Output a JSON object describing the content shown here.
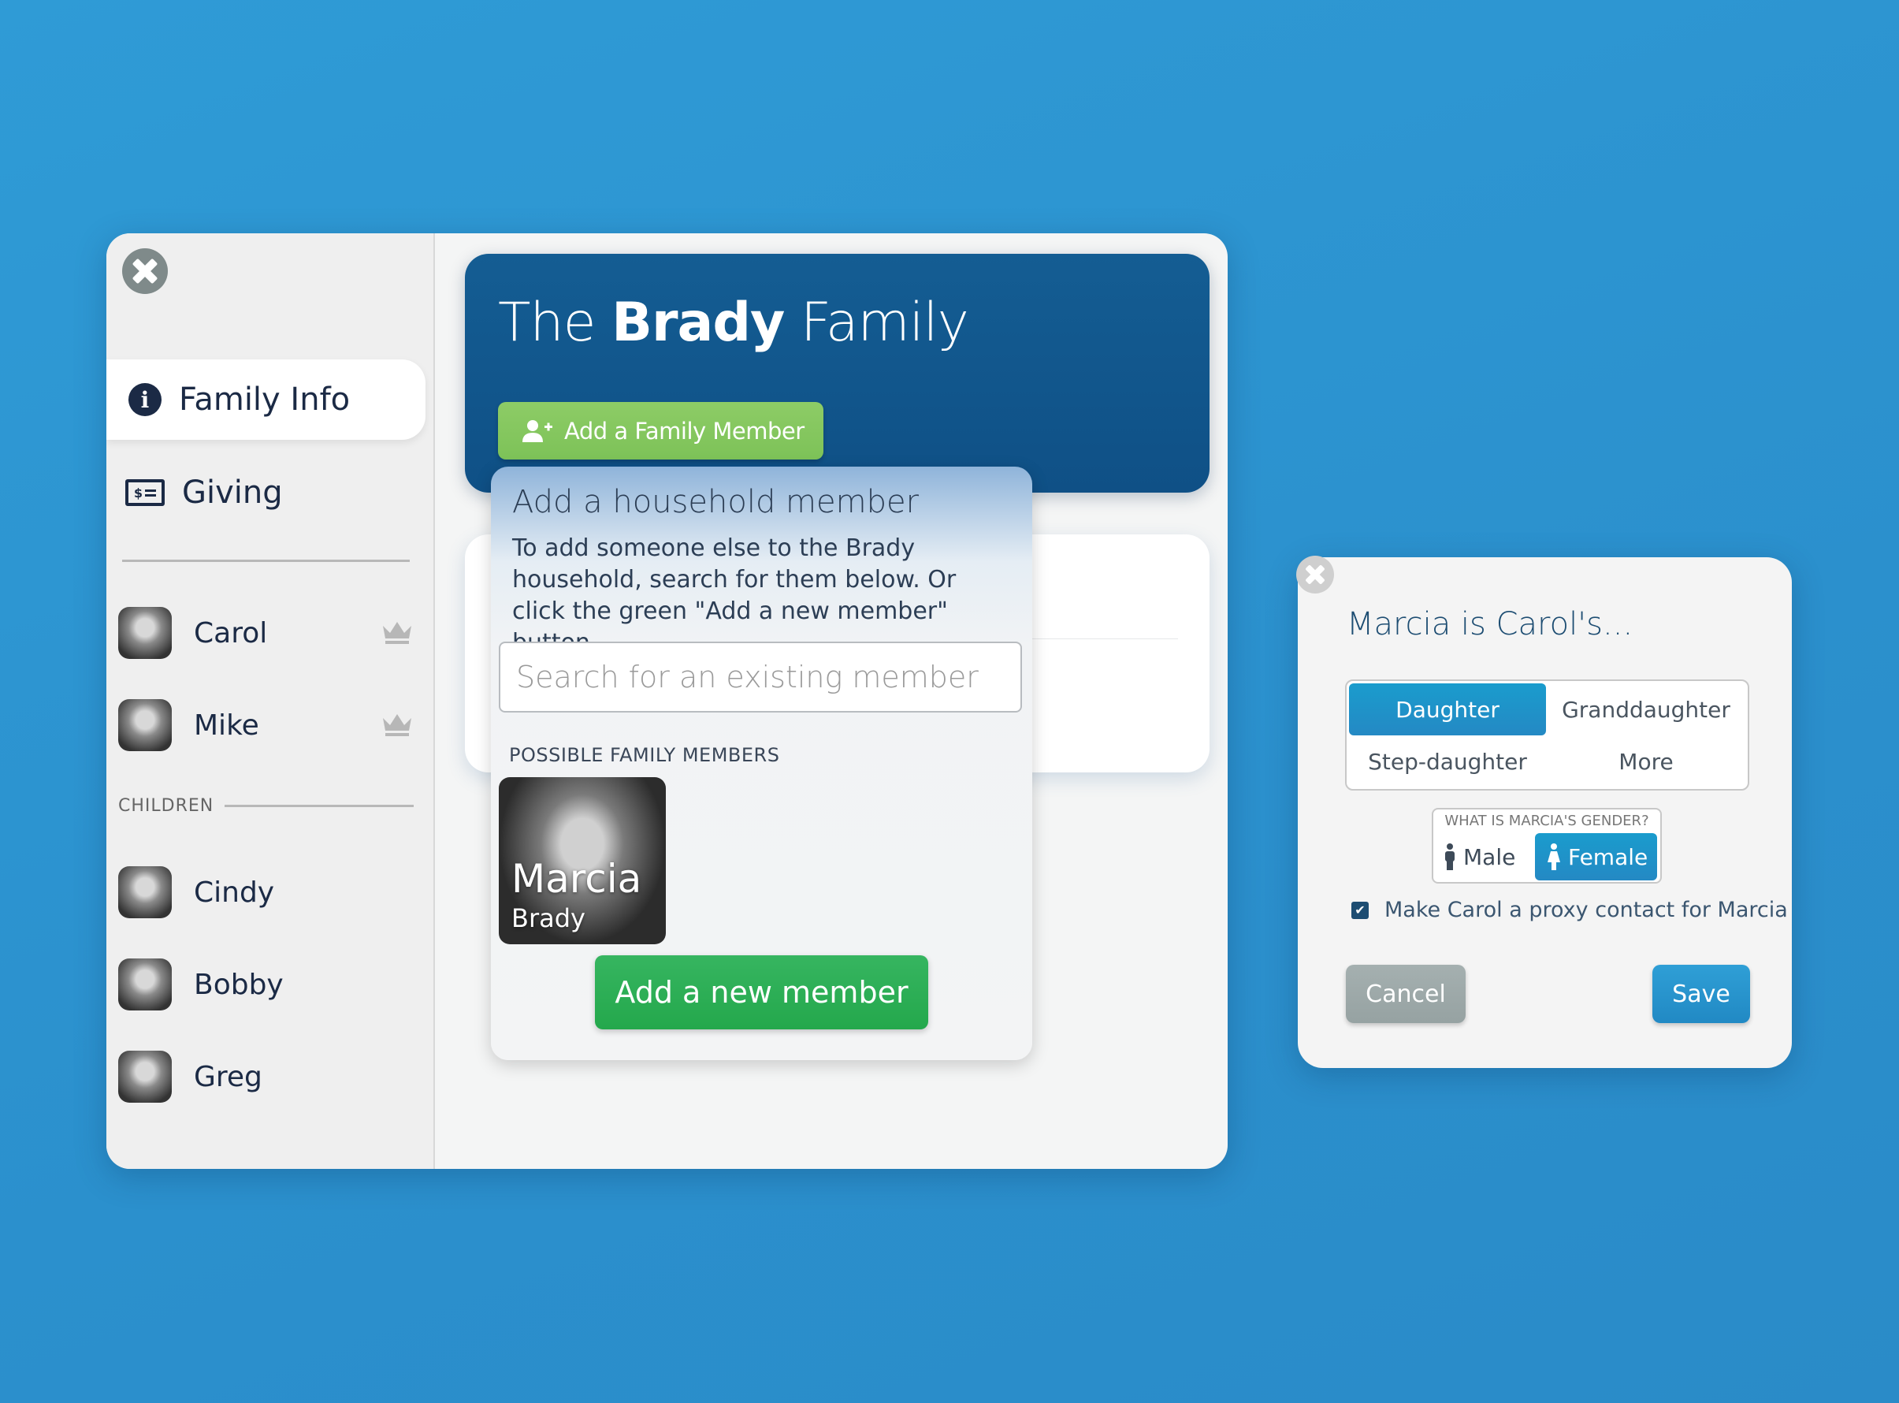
{
  "colors": {
    "background": "#2f9bd6",
    "header_blue": "#145d93",
    "green_button": "#7dc258",
    "add_new_green": "#24a84c",
    "selected_blue": "#1a9ccd",
    "navy_text": "#1b2a45",
    "cancel_gray": "#96a2a2"
  },
  "sidebar": {
    "close_icon": "close-icon",
    "nav": [
      {
        "label": "Family Info",
        "icon": "info-icon",
        "active": true
      },
      {
        "label": "Giving",
        "icon": "check-money-icon",
        "active": false
      }
    ],
    "parents": [
      {
        "name": "Carol",
        "icon": "crown-icon"
      },
      {
        "name": "Mike",
        "icon": "crown-icon"
      }
    ],
    "children_label": "CHILDREN",
    "children": [
      {
        "name": "Cindy"
      },
      {
        "name": "Bobby"
      },
      {
        "name": "Greg"
      }
    ]
  },
  "header": {
    "title_prefix": "The",
    "title_bold": "Brady",
    "title_suffix": "Family",
    "add_button_label": "Add a Family Member",
    "add_button_icon": "user-plus-icon"
  },
  "popover": {
    "title": "Add a household member",
    "description": "To add someone else to the Brady household, search for them below. Or click the green \"Add a new member\" button.",
    "search_placeholder": "Search for an existing member",
    "search_value": "",
    "possible_label": "POSSIBLE FAMILY MEMBERS",
    "possible_members": [
      {
        "first": "Marcia",
        "last": "Brady"
      }
    ],
    "add_new_label": "Add a new member"
  },
  "relationship_dialog": {
    "title": "Marcia is Carol's...",
    "options": [
      {
        "label": "Daughter",
        "selected": true
      },
      {
        "label": "Granddaughter",
        "selected": false
      },
      {
        "label": "Step-daughter",
        "selected": false
      },
      {
        "label": "More",
        "selected": false
      }
    ],
    "gender_question": "WHAT IS MARCIA'S GENDER?",
    "gender_options": [
      {
        "label": "Male",
        "icon": "male-icon",
        "selected": false
      },
      {
        "label": "Female",
        "icon": "female-icon",
        "selected": true
      }
    ],
    "proxy_checked": true,
    "proxy_label": "Make Carol a proxy contact for Marcia",
    "cancel_label": "Cancel",
    "save_label": "Save"
  }
}
